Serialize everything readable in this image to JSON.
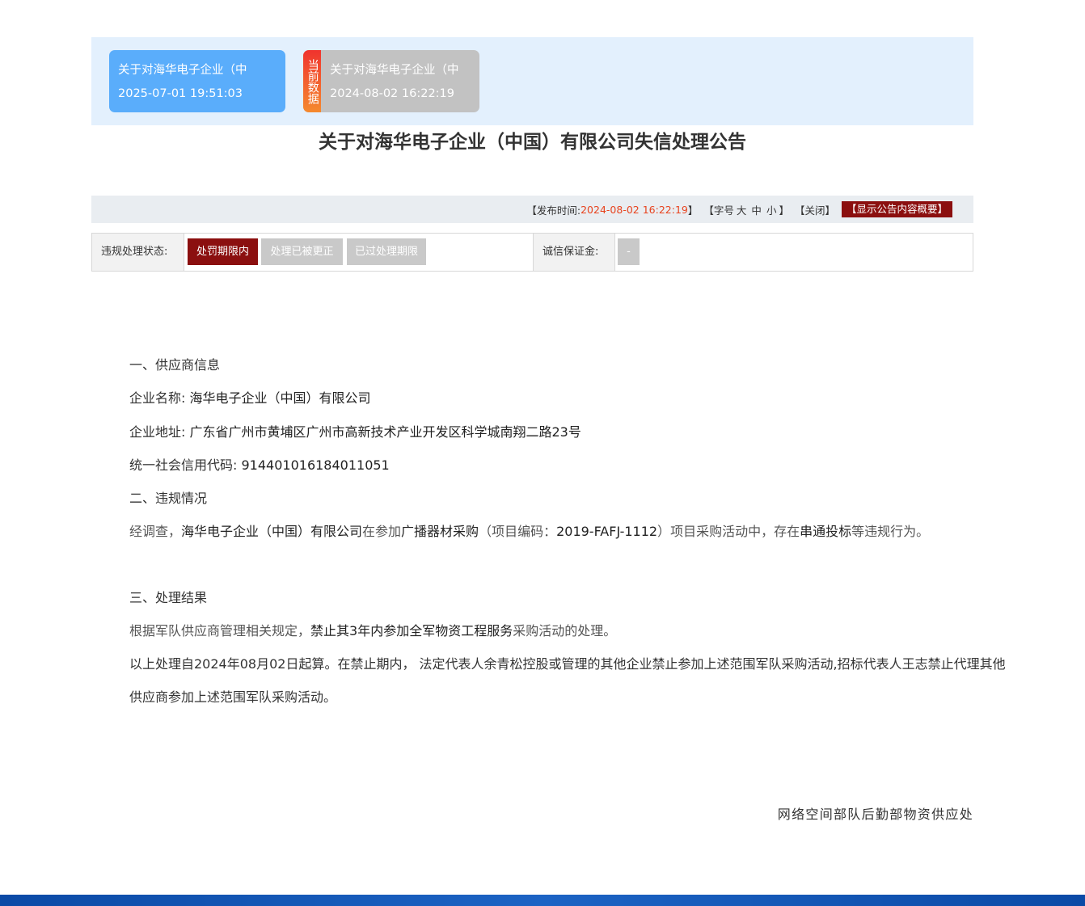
{
  "versions": [
    {
      "title": "关于对海华电子企业（中",
      "date": "2025-07-01 19:51:03"
    },
    {
      "title": "关于对海华电子企业（中",
      "date": "2024-08-02 16:22:19",
      "tag": "当前数据"
    }
  ],
  "title": "关于对海华电子企业（中国）有限公司失信处理公告",
  "info": {
    "publish_prefix": "【发布时间: ",
    "publish_time": "2024-08-02 16:22:19",
    "publish_suffix": "】",
    "font_prefix": "【字号",
    "font_large": "大",
    "font_medium": "中",
    "font_small": "小",
    "font_suffix": "】",
    "close": "【关闭】",
    "summary": "【显示公告内容概要】"
  },
  "status": {
    "label": "违规处理状态:",
    "options": [
      "处罚期限内",
      "处理已被更正",
      "已过处理期限"
    ],
    "deposit_label": "诚信保证金:",
    "deposit_value": "-"
  },
  "body": {
    "h1": "一、供应商信息",
    "name_label": "企业名称:",
    "name_value": "海华电子企业（中国）有限公司",
    "addr_label": "企业地址:",
    "addr_value": "广东省广州市黄埔区广州市高新技术产业开发区科学城南翔二路23号",
    "code_label": "统一社会信用代码:",
    "code_value": "914401016184011051",
    "h2": "二、违规情况",
    "v1": "经调查，",
    "v2": "海华电子企业（中国）有限公司",
    "v3": "在参加",
    "v4": "广播器材采购",
    "v5": "（项目编码：",
    "v6": "2019-FAFJ-1112",
    "v7": "）项目采购活动中，存在",
    "v8": "串通投标",
    "v9": "等违规行为。",
    "h3": "三、处理结果",
    "r1": "根据军队供应商管理相关规定，",
    "r2": "禁止其3年内参加全军物资工程服务",
    "r3": "采购活动的处理。",
    "p_last": "以上处理自2024年08月02日起算。在禁止期内， 法定代表人余青松控股或管理的其他企业禁止参加上述范围军队采购活动,招标代表人王志禁止代理其他供应商参加上述范围军队采购活动。"
  },
  "signature": "网络空间部队后勤部物资供应处"
}
